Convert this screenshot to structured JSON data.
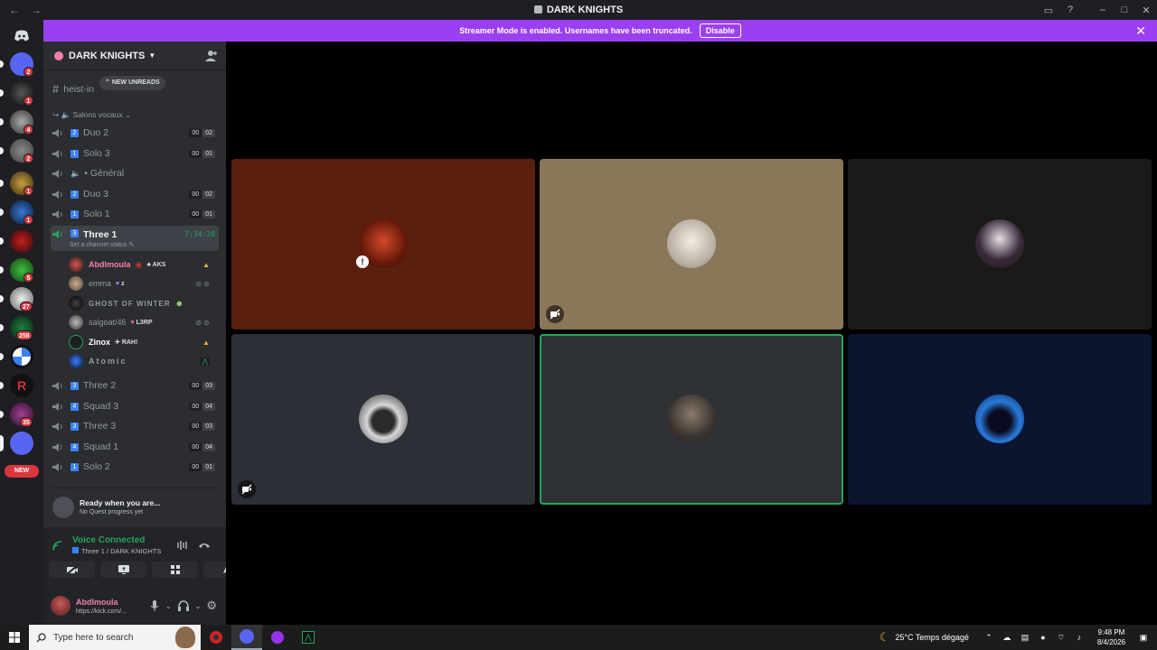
{
  "window": {
    "title": "DARK KNIGHTS",
    "back_icon": "←",
    "forward_icon": "→"
  },
  "banner": {
    "text": "Streamer Mode is enabled. Usernames have been truncated.",
    "button": "Disable"
  },
  "rail": {
    "badges": [
      "2",
      "1",
      "4",
      "2",
      "1",
      "1",
      "5",
      "27",
      "258",
      "35"
    ],
    "new_label": "NEW"
  },
  "guild": {
    "name": "DARK KNIGHTS"
  },
  "channels": {
    "heist": "heist-in",
    "new_unreads": "NEW UNREADS",
    "category": "Salons vocaux",
    "list": [
      {
        "limit": "2",
        "name": "Duo 2",
        "c1": "00",
        "c2": "02"
      },
      {
        "limit": "1",
        "name": "Solo 3",
        "c1": "00",
        "c2": "01"
      },
      {
        "limit": "",
        "name": "• Général",
        "c1": "",
        "c2": ""
      },
      {
        "limit": "2",
        "name": "Duo 3",
        "c1": "00",
        "c2": "02"
      },
      {
        "limit": "1",
        "name": "Solo 1",
        "c1": "00",
        "c2": "01"
      }
    ],
    "active": {
      "limit": "3",
      "name": "Three 1",
      "timer": "7:34:20",
      "status": "Set a channel status"
    },
    "members": [
      {
        "name": "Abdlmoula",
        "tag": "AKS",
        "color": "#f47fab"
      },
      {
        "name": "emma",
        "tag": "z",
        "color": "#949ba4"
      },
      {
        "name": "GHOST OF WINTER",
        "tag": "",
        "color": "#949ba4"
      },
      {
        "name": "salgoat/46",
        "tag": "L3RP",
        "color": "#949ba4"
      },
      {
        "name": "Zinox",
        "tag": "RAH!",
        "color": "#ffffff"
      },
      {
        "name": "Atomic",
        "tag": "",
        "color": "#949ba4"
      }
    ],
    "list2": [
      {
        "limit": "3",
        "name": "Three 2",
        "c1": "00",
        "c2": "03"
      },
      {
        "limit": "4",
        "name": "Squad 3",
        "c1": "00",
        "c2": "04"
      },
      {
        "limit": "3",
        "name": "Three 3",
        "c1": "00",
        "c2": "03"
      },
      {
        "limit": "4",
        "name": "Squad 1",
        "c1": "00",
        "c2": "04"
      },
      {
        "limit": "1",
        "name": "Solo 2",
        "c1": "00",
        "c2": "01"
      }
    ]
  },
  "quest": {
    "title": "Ready when you are...",
    "subtitle": "No Quest progress yet"
  },
  "voice": {
    "status": "Voice Connected",
    "channel": "Three 1 / DARK KNIGHTS"
  },
  "me": {
    "name": "Abdlmoula",
    "status": "https://kick.com/..."
  },
  "taskbar": {
    "search_placeholder": "Type here to search",
    "weather": "25°C  Temps dégagé",
    "time": "9:48 PM",
    "date": "8/4/2026"
  }
}
